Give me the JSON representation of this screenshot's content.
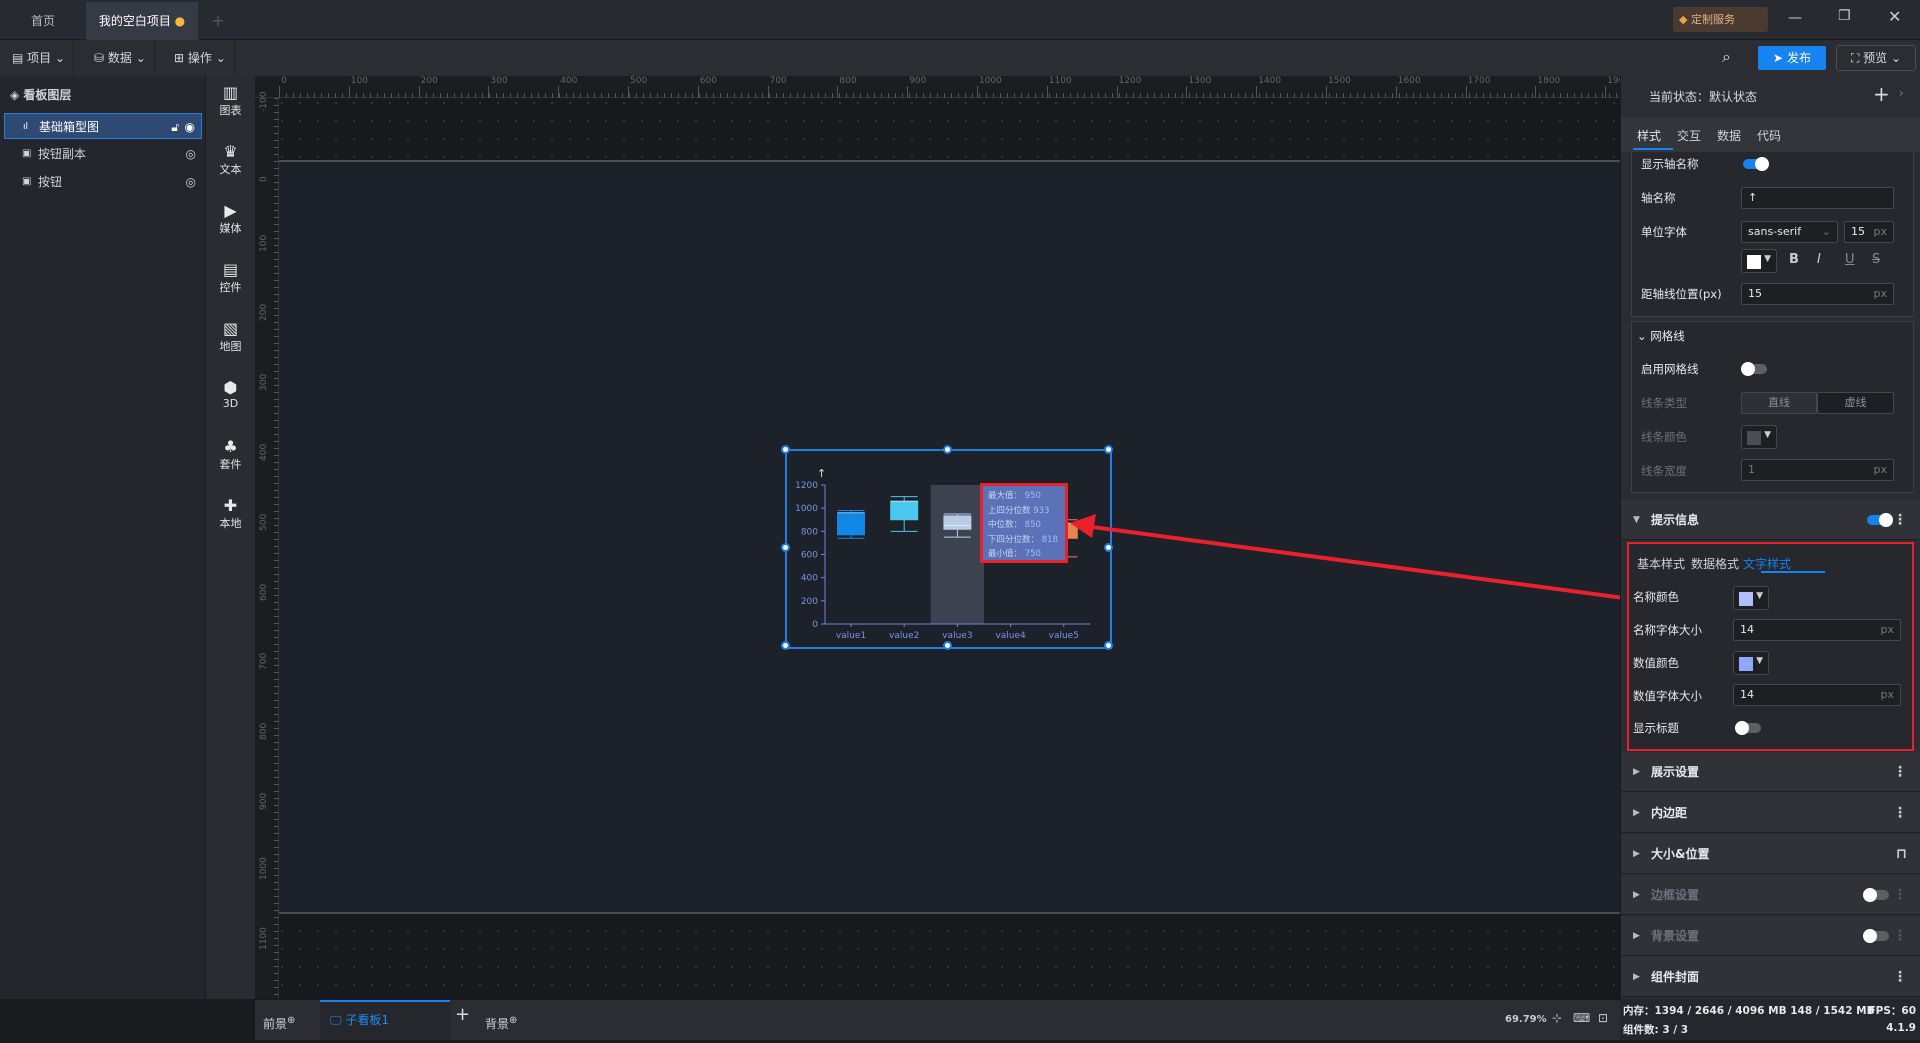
{
  "titlebar": {
    "tabs": [
      {
        "label": "首页"
      },
      {
        "label": "我的空白项目",
        "modified": true
      }
    ],
    "add_tab": "+",
    "service_label": "定制服务",
    "window_controls": [
      "minimize-icon",
      "restore-icon",
      "close-icon"
    ]
  },
  "toolbar": {
    "menus": [
      {
        "label": "项目",
        "icon": "file-icon"
      },
      {
        "label": "数据",
        "icon": "database-icon"
      },
      {
        "label": "操作",
        "icon": "grid-icon"
      }
    ],
    "publish_label": "发布",
    "preview_label": "预览"
  },
  "layers": {
    "title": "看板图层",
    "items": [
      {
        "label": "基础箱型图",
        "selected": true
      },
      {
        "label": "按钮副本"
      },
      {
        "label": "按钮"
      }
    ]
  },
  "components": [
    {
      "label": "图表",
      "icon": "bar-chart-icon"
    },
    {
      "label": "文本",
      "icon": "text-icon"
    },
    {
      "label": "媒体",
      "icon": "media-icon"
    },
    {
      "label": "控件",
      "icon": "widget-icon"
    },
    {
      "label": "地图",
      "icon": "map-icon"
    },
    {
      "label": "3D",
      "icon": "cube-icon"
    },
    {
      "label": "套件",
      "icon": "suit-icon"
    },
    {
      "label": "本地",
      "icon": "puzzle-icon"
    }
  ],
  "rulers": {
    "top": [
      "0",
      "100",
      "200",
      "300",
      "400",
      "500",
      "600",
      "700",
      "800",
      "900",
      "1000",
      "1100",
      "1200",
      "1300",
      "1400",
      "1500",
      "1600",
      "1700",
      "1800",
      "1900"
    ],
    "left": [
      "-100",
      "0",
      "100",
      "200",
      "300",
      "400",
      "500",
      "600",
      "700",
      "800",
      "900",
      "1000",
      "1100"
    ]
  },
  "chart_data": {
    "type": "boxplot",
    "axis_name": "↑",
    "categories": [
      "value1",
      "value2",
      "value3",
      "value4",
      "value5"
    ],
    "ylim": [
      0,
      1200
    ],
    "yticks": [
      "0",
      "200",
      "400",
      "600",
      "800",
      "1000",
      "1200"
    ],
    "series": [
      {
        "category": "value1",
        "min": 740,
        "q1": 770,
        "median": 960,
        "q3": 960,
        "max": 980,
        "color": "#1088e8"
      },
      {
        "category": "value2",
        "min": 800,
        "q1": 900,
        "median": 1060,
        "q3": 1060,
        "max": 1100,
        "color": "#4cc8f0"
      },
      {
        "category": "value3",
        "min": 750,
        "q1": 818,
        "median": 850,
        "q3": 933,
        "max": 950,
        "color": "#b8cce8"
      },
      {
        "category": "value4",
        "min": 750,
        "q1": 818,
        "median": 850,
        "q3": 933,
        "max": 950,
        "color": "#e8a04a"
      },
      {
        "category": "value5",
        "min": 580,
        "q1": 740,
        "median": 870,
        "q3": 870,
        "max": 900,
        "color": "#e8834a"
      }
    ],
    "grid": false,
    "highlight": "value3",
    "tooltip": {
      "rows": [
        {
          "label": "最大值：",
          "value": "950"
        },
        {
          "label": "上四分位数",
          "value": "933"
        },
        {
          "label": "中位数：",
          "value": "850"
        },
        {
          "label": "下四分位数：",
          "value": "818"
        },
        {
          "label": "最小值：",
          "value": "750"
        }
      ]
    }
  },
  "right": {
    "state_label": "当前状态：默认状态",
    "tabs": [
      "样式",
      "交互",
      "数据",
      "代码"
    ],
    "axis": {
      "show_name_label": "显示轴名称",
      "show_name": true,
      "name_label": "轴名称",
      "name_value": "↑",
      "font_label": "单位字体",
      "font_value": "sans-serif",
      "font_size": "15",
      "unit": "px",
      "color": "#ffffff",
      "distance_label": "距轴线位置(px)",
      "distance_value": "15"
    },
    "grid": {
      "title": "网格线",
      "enable_label": "启用网格线",
      "enabled": false,
      "line_type_label": "线条类型",
      "line_types": [
        "直线",
        "虚线"
      ],
      "line_color_label": "线条颜色",
      "line_color": "#4a4d58",
      "line_width_label": "线条宽度",
      "line_width": "1"
    },
    "tooltip": {
      "title": "提示信息",
      "enabled": true,
      "subtabs": [
        "基本样式",
        "数据格式",
        "文字样式"
      ],
      "active_subtab": 2,
      "name_color_label": "名称颜色",
      "name_color": "#b0c0ff",
      "name_size_label": "名称字体大小",
      "name_size": "14",
      "value_color_label": "数值颜色",
      "value_color": "#8ea8ff",
      "value_size_label": "数值字体大小",
      "value_size": "14",
      "show_title_label": "显示标题",
      "show_title": false
    },
    "sections": [
      {
        "label": "展示设置",
        "action": "more"
      },
      {
        "label": "内边距",
        "action": "more"
      },
      {
        "label": "大小&位置",
        "action": "lock"
      },
      {
        "label": "边框设置",
        "action": "toggle",
        "dim": true
      },
      {
        "label": "背景设置",
        "action": "toggle",
        "dim": true
      },
      {
        "label": "组件封面",
        "action": "more"
      }
    ]
  },
  "bottom": {
    "foreground": "前景",
    "subboard": "子看板1",
    "add": "+",
    "background": "背景",
    "zoom": "69.79%"
  },
  "status": {
    "memory": "内存：1394 / 2646 / 4096 MB  148 / 1542 MB",
    "fps": "FPS：60",
    "components": "组件数: 3 / 3",
    "version": "4.1.9"
  },
  "colors": {
    "accent": "#1683f0",
    "highlight_box": "#e8212a"
  }
}
